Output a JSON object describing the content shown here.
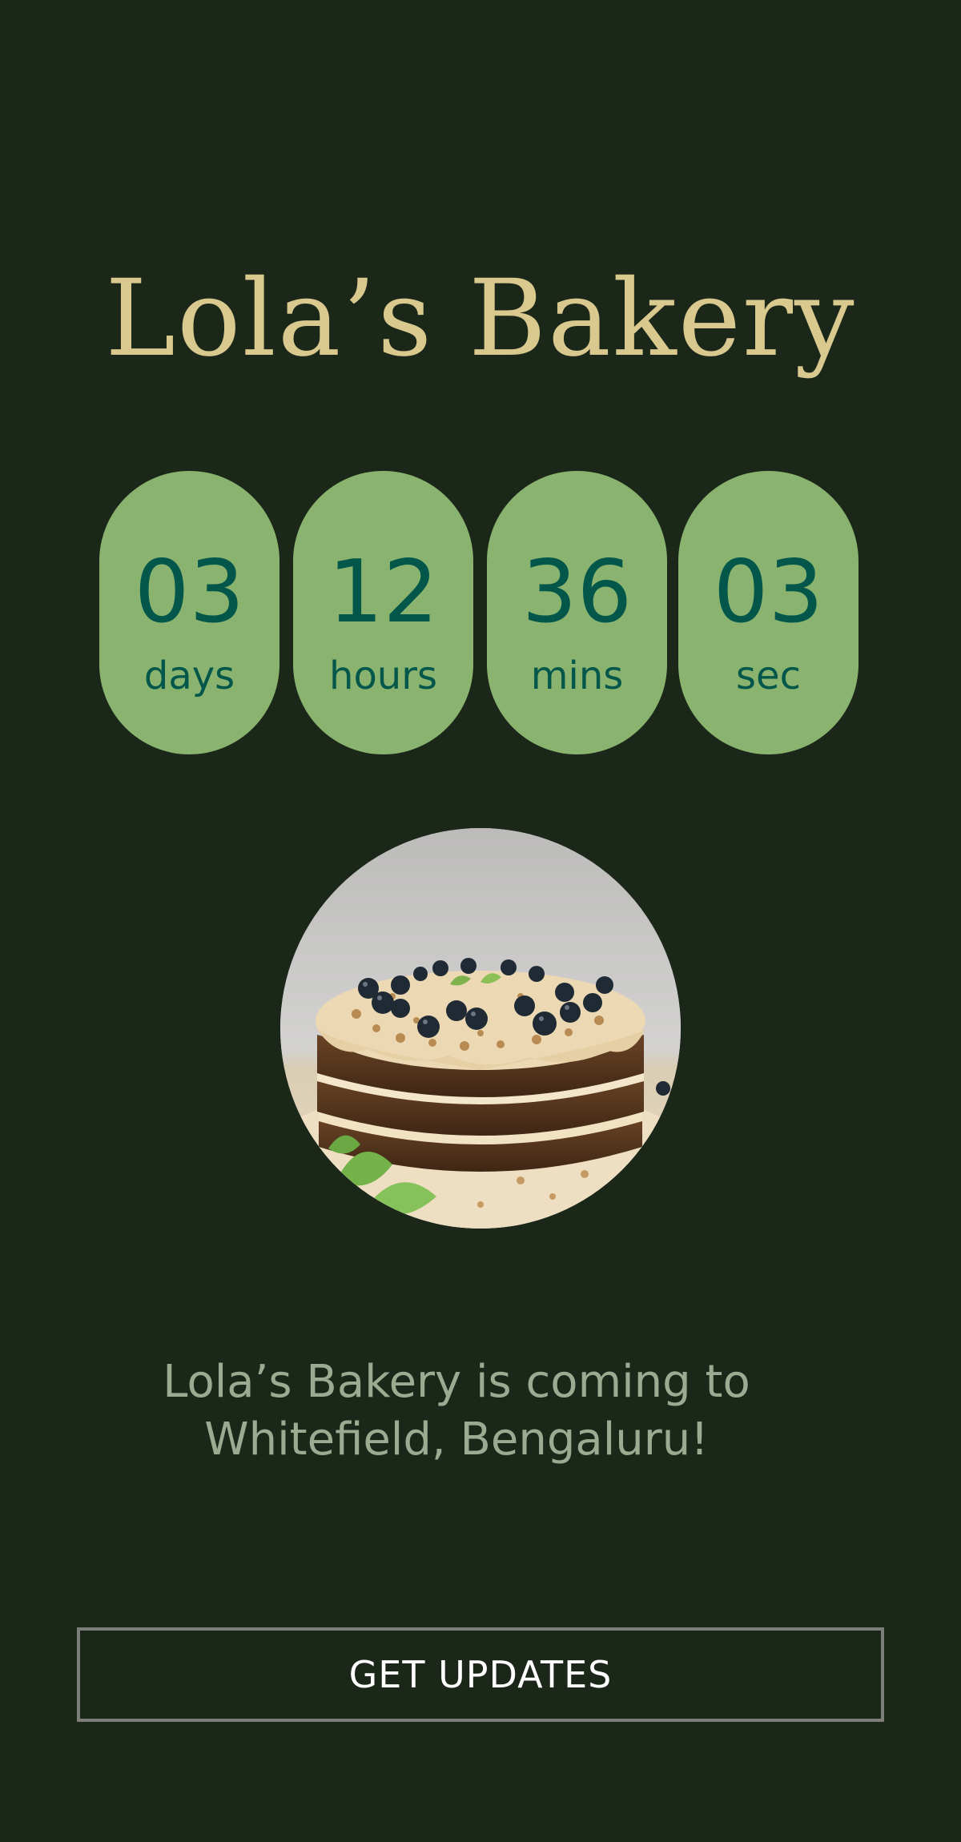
{
  "brand": {
    "title": "Lola’s Bakery"
  },
  "countdown": [
    {
      "value": "03",
      "unit": "days"
    },
    {
      "value": "12",
      "unit": "hours"
    },
    {
      "value": "36",
      "unit": "mins"
    },
    {
      "value": "03",
      "unit": "sec"
    }
  ],
  "hero_image": {
    "subject": "layered-cake-with-blueberries"
  },
  "announcement": {
    "line1": "Lola’s Bakery is coming to",
    "line2": "Whitefield, Bengaluru!"
  },
  "cta": {
    "label": "GET UPDATES"
  },
  "colors": {
    "background": "#1b2718",
    "title": "#d9c98f",
    "pill": "#89b36f",
    "pill_text": "#02574a",
    "tagline": "#9daa92",
    "button_border": "#7c7f79"
  }
}
